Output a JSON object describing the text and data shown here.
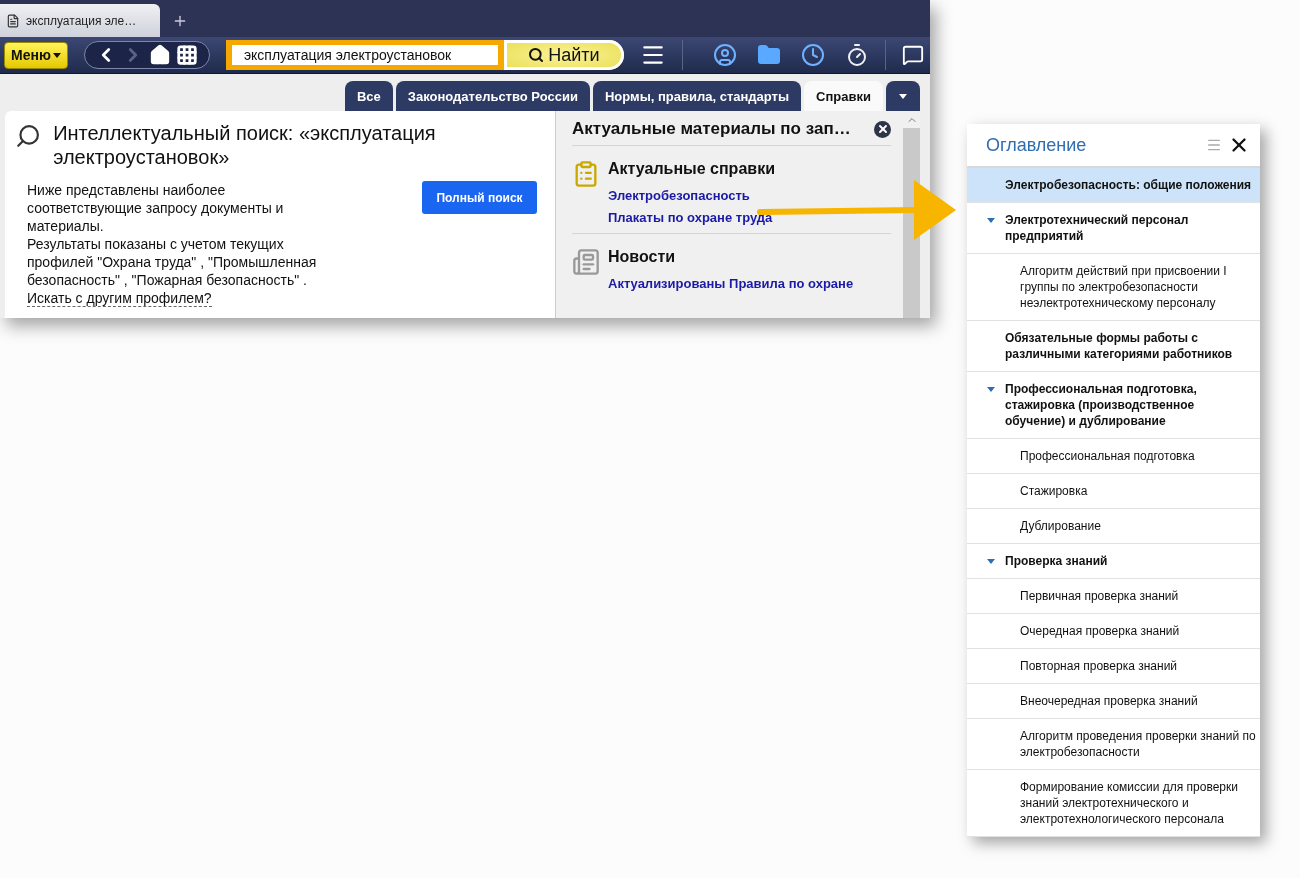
{
  "browser_tab": {
    "title": "эксплуатация элe…"
  },
  "toolbar": {
    "menu_label": "Меню",
    "search_value": "эксплуатация электроустановок",
    "search_button": "Найти"
  },
  "category_tabs": [
    {
      "label": "Все",
      "selected": false
    },
    {
      "label": "Законодательство России",
      "selected": false
    },
    {
      "label": "Нормы, правила, стандарты",
      "selected": false
    },
    {
      "label": "Справки",
      "selected": true
    }
  ],
  "search_card": {
    "title": "Интеллектуальный поиск: «эксплуатация электроустановок»",
    "paragraphs": [
      "Ниже представлены наиболее соответствующие запросу документы и материалы.",
      "Результаты показаны с учетом текущих профилей \"Охрана труда\" , \"Промышленная безопасность\" , \"Пожарная безопасность\" ."
    ],
    "profile_link": "Искать с другим профилем?",
    "full_search_button": "Полный поиск"
  },
  "materials_panel": {
    "title": "Актуальные материалы по зап…",
    "sections": [
      {
        "kind": "references",
        "title": "Актуальные справки",
        "links": [
          "Электробезопасность",
          "Плакаты по охране труда"
        ]
      },
      {
        "kind": "news",
        "title": "Новости",
        "links": [
          "Актуализированы Правила по охране"
        ]
      }
    ]
  },
  "toc": {
    "title": "Оглавление",
    "items": [
      {
        "label": "Электробезопасность: общие положения",
        "selected": true
      },
      {
        "label": "Электротехнический персонал предприятий",
        "selected": false,
        "expanded": true,
        "children": [
          {
            "label": "Алгоритм действий при присвоении I группы по электробезопасности неэлектротехническому персоналу",
            "selected": false
          }
        ]
      },
      {
        "label": "Обязательные формы работы с различными категориями работников",
        "selected": false
      },
      {
        "label": "Профессиональная подготовка, стажировка (производственное обучение) и дублирование",
        "selected": false,
        "expanded": true,
        "children": [
          {
            "label": "Профессиональная подготовка",
            "selected": false
          },
          {
            "label": "Стажировка",
            "selected": false
          },
          {
            "label": "Дублирование",
            "selected": false
          }
        ]
      },
      {
        "label": "Проверка знаний",
        "selected": false,
        "expanded": true,
        "children": [
          {
            "label": "Первичная проверка знаний",
            "selected": false
          },
          {
            "label": "Очередная проверка знаний",
            "selected": false
          },
          {
            "label": "Повторная проверка знаний",
            "selected": false
          },
          {
            "label": "Внеочередная проверка знаний",
            "selected": false
          },
          {
            "label": "Алгоритм проведения проверки знаний по электробезопасности",
            "selected": false
          },
          {
            "label": "Формирование комиссии для проверки знаний электротехнического и электротехнологического персонала",
            "selected": false
          }
        ]
      }
    ]
  }
}
